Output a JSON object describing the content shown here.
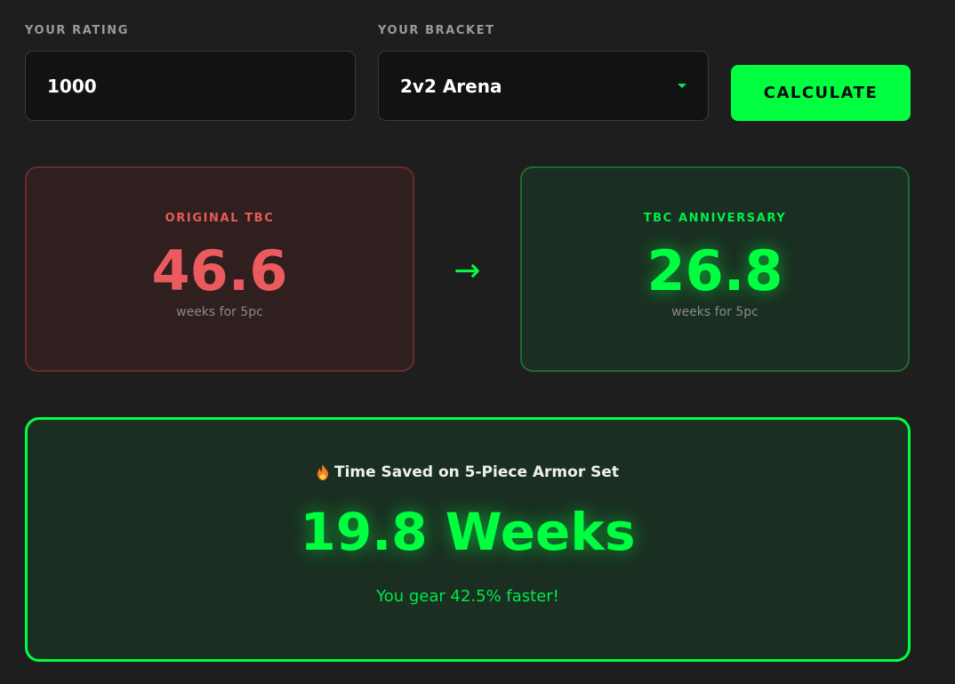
{
  "form": {
    "rating_label": "YOUR RATING",
    "rating_value": "1000",
    "bracket_label": "YOUR BRACKET",
    "bracket_value": "2v2 Arena",
    "calculate_label": "CALCULATE"
  },
  "comparison": {
    "original": {
      "title": "ORIGINAL TBC",
      "value": "46.6",
      "unit_text": "weeks for 5pc"
    },
    "arrow": "→",
    "anniversary": {
      "title": "TBC ANNIVERSARY",
      "value": "26.8",
      "unit_text": "weeks for 5pc"
    }
  },
  "savings": {
    "icon": "fire-icon",
    "title": "Time Saved on 5-Piece Armor Set",
    "value": "19.8 Weeks",
    "subtitle": "You gear 42.5% faster!"
  },
  "colors": {
    "accent_green": "#00ff41",
    "original_red": "#ea5a5e",
    "background": "#1e1e1e"
  }
}
